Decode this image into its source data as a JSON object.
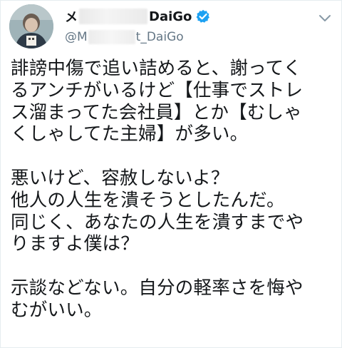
{
  "tweet": {
    "author": {
      "display_name_prefix": "メ",
      "display_name_suffix": "DaiGo",
      "handle_prefix": "@M",
      "handle_suffix": "t_DaiGo"
    },
    "icons": {
      "verified": "verified-badge-icon",
      "menu": "chevron-down-icon"
    },
    "colors": {
      "verified": "#1da1f2",
      "handle": "#657786",
      "text": "#14171a"
    },
    "paragraphs": [
      {
        "lines": [
          "誹謗中傷で追い詰めると、謝ってく",
          "るアンチがいるけど【仕事でストレ",
          "ス溜まってた会社員】とか【むしゃ",
          "くしゃしてた主婦】が多い。"
        ]
      },
      {
        "lines": [
          "悪いけど、容赦しないよ？",
          "他人の人生を潰そうとしたんだ。",
          "同じく、あなたの人生を潰すまでや",
          "りますよ僕は？"
        ]
      },
      {
        "lines": [
          "示談などない。自分の軽率さを悔や",
          "むがいい。"
        ]
      }
    ]
  }
}
